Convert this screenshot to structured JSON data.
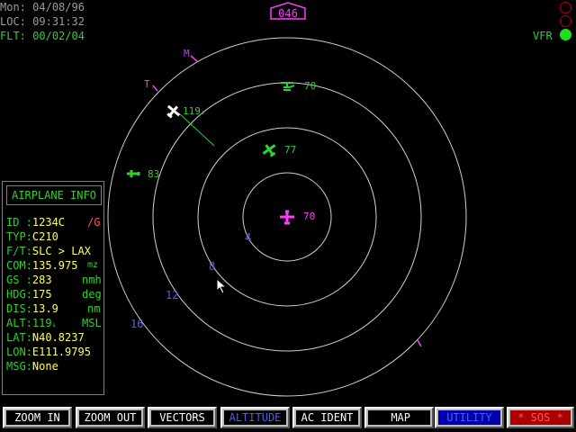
{
  "header": {
    "mon_label": "Mon:",
    "mon_value": "04/08/96",
    "loc_label": "LOC:",
    "loc_value": "09:31:32",
    "flt_label": "FLT:",
    "flt_value": "00/02/04"
  },
  "heading": "046",
  "flight_rules": "VFR",
  "compass_markers": [
    "M",
    "T"
  ],
  "range_labels": [
    "4",
    "8",
    "12",
    "16"
  ],
  "aircraft": [
    {
      "type": "jet",
      "color": "#ff3cff",
      "altitude": "70",
      "selected": true
    },
    {
      "type": "jet",
      "color": "#2ed12e",
      "altitude": "77"
    },
    {
      "type": "jet",
      "color": "#ffffff",
      "altitude": "119",
      "trend": "↓"
    },
    {
      "type": "prop",
      "color": "#2ed12e",
      "altitude": "83"
    },
    {
      "type": "helicopter",
      "color": "#2ed12e",
      "altitude": "70"
    }
  ],
  "info_panel": {
    "title": "AIRPLANE INFO",
    "rows": [
      {
        "label": "ID :",
        "value": "1234C",
        "extra": "/G"
      },
      {
        "label": "TYP:",
        "value": "C210"
      },
      {
        "label": "F/T:",
        "value": "SLC > LAX"
      },
      {
        "label": "COM:",
        "value": "135.975",
        "unit": "mz"
      },
      {
        "label": "GS :",
        "value": "283",
        "unit": "nmh"
      },
      {
        "label": "HDG:",
        "value": "175",
        "unit": "deg"
      },
      {
        "label": "DIS:",
        "value": "13.9",
        "unit": "nm"
      },
      {
        "label": "ALT:",
        "value": "119",
        "trend": "↓",
        "unit": "MSL"
      },
      {
        "label": "LAT:",
        "value": "N40.8237"
      },
      {
        "label": "LON:",
        "value": "E111.9795"
      },
      {
        "label": "MSG:",
        "value": "None"
      }
    ]
  },
  "buttons": [
    "ZOOM IN",
    "ZOOM OUT",
    "VECTORS",
    "ALTITUDE",
    "AC IDENT",
    "MAP",
    "UTILITY",
    "* SOS *"
  ],
  "colors": {
    "accent_magenta": "#ff3cff",
    "radar_ring": "#d0d0d0",
    "text_green": "#2ed12e",
    "value_yellow": "#ffff55",
    "range_blue": "#5a5aff"
  }
}
